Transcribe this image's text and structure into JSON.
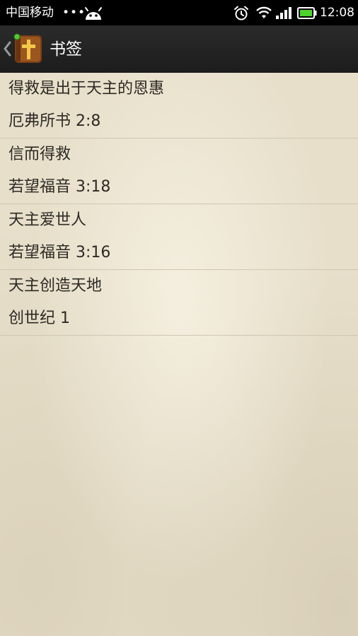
{
  "status_bar": {
    "carrier": "中国移动",
    "dots": "•••",
    "time": "12:08",
    "icons": [
      "android-icon",
      "alarm-icon",
      "wifi-icon",
      "signal-icon",
      "battery-icon"
    ]
  },
  "action_bar": {
    "title": "书签",
    "app_icon": "bible-cross-icon",
    "back_icon": "chevron-left-icon"
  },
  "bookmarks": [
    {
      "title": "得救是出于天主的恩惠",
      "reference": "厄弗所书 2:8"
    },
    {
      "title": "信而得救",
      "reference": "若望福音 3:18"
    },
    {
      "title": "天主爱世人",
      "reference": "若望福音 3:16"
    },
    {
      "title": "天主创造天地",
      "reference": "创世纪 1"
    }
  ],
  "colors": {
    "status_bar_bg": "#000000",
    "action_bar_bg": "#222222",
    "paper_bg": "#e7dfca",
    "text": "#2d2a25",
    "divider": "#cfc7b2",
    "battery_green": "#4bd42c",
    "icon_brown": "#8a4b1c",
    "icon_gold": "#f0c040"
  }
}
